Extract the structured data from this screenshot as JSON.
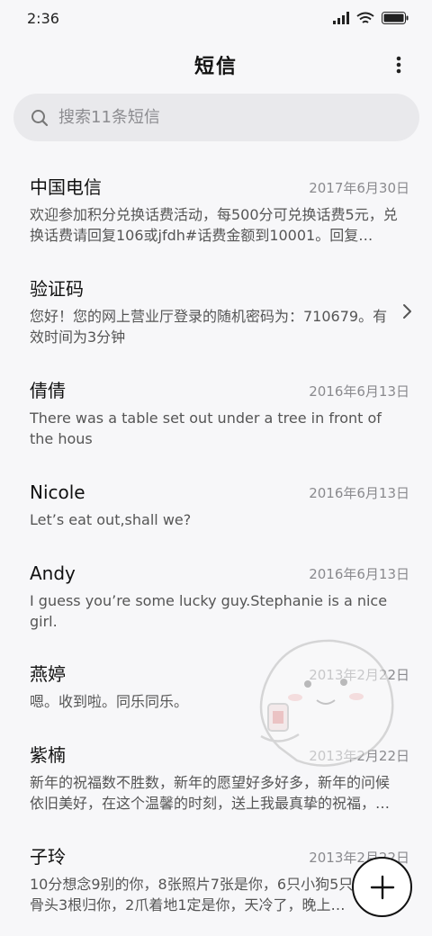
{
  "status_bar": {
    "time": "2:36"
  },
  "header": {
    "title": "短信"
  },
  "search": {
    "placeholder": "搜索11条短信"
  },
  "conversations": [
    {
      "sender": "中国电信",
      "date": "2017年6月30日",
      "preview": "欢迎参加积分兑换话费活动，每500分可兑换话费5元，兑换话费请回复106或jfdh#话费金额到10001。回复…"
    },
    {
      "sender": "验证码",
      "date": "",
      "preview": "您好！您的网上营业厅登录的随机密码为：710679。有效时间为3分钟"
    },
    {
      "sender": "倩倩",
      "date": "2016年6月13日",
      "preview": "There was a table set out under a tree in front of the hous"
    },
    {
      "sender": "Nicole",
      "date": "2016年6月13日",
      "preview": "Let’s eat out,shall we?"
    },
    {
      "sender": "Andy",
      "date": "2016年6月13日",
      "preview": "I guess you’re some lucky guy.Stephanie is a nice girl."
    },
    {
      "sender": "燕婷",
      "date": "2013年2月22日",
      "preview": "嗯。收到啦。同乐同乐。"
    },
    {
      "sender": "紫楠",
      "date": "2013年2月22日",
      "preview": "新年的祝福数不胜数，新年的愿望好多好多，新年的问候依旧美好，在这个温馨的时刻，送上我最真挚的祝福，…"
    },
    {
      "sender": "子玲",
      "date": "2013年2月22日",
      "preview": "10分想念9别的你，8张照片7张是你，6只小狗5只，4根骨头3根归你，2爪着地1定是你，天冷了，晚上…"
    }
  ],
  "icons": {
    "signal": "signal-icon",
    "wifi": "wifi-icon",
    "battery": "battery-icon",
    "more": "more-vertical-icon",
    "search": "search-icon",
    "chevron": "chevron-right-icon",
    "compose": "plus-icon",
    "sticker": "sticker-icon"
  }
}
